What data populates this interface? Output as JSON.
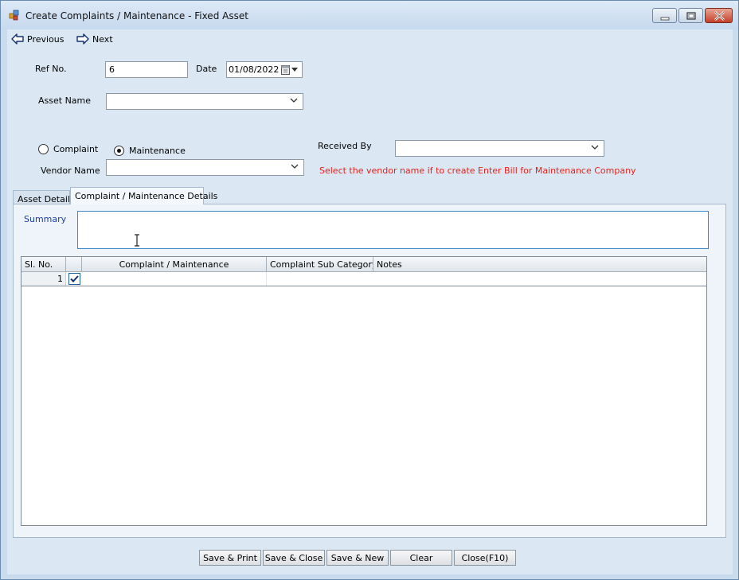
{
  "window": {
    "title": "Create Complaints / Maintenance - Fixed Asset"
  },
  "nav": {
    "previous": "Previous",
    "next": "Next"
  },
  "form": {
    "ref_label": "Ref No.",
    "ref_value": "6",
    "date_label": "Date",
    "date_value": "01/08/2022",
    "asset_label": "Asset Name",
    "asset_value": "",
    "radio_complaint": "Complaint",
    "radio_maintenance": "Maintenance",
    "selected_type": "Maintenance",
    "received_by_label": "Received By",
    "received_by_value": "",
    "vendor_label": "Vendor Name",
    "vendor_value": "",
    "vendor_hint": "Select the vendor name if to  create Enter Bill for Maintenance Company"
  },
  "tabs": [
    {
      "label": "Asset Details",
      "active": false
    },
    {
      "label": "Complaint / Maintenance Details",
      "active": true
    }
  ],
  "details": {
    "summary_label": "Summary",
    "summary_value": "",
    "columns": [
      "Sl. No.",
      "",
      "Complaint / Maintenance",
      "Complaint Sub Category",
      "Notes"
    ],
    "rows": [
      {
        "sl_no": "1",
        "checked": true,
        "complaint": "",
        "sub_category": "",
        "notes": ""
      }
    ]
  },
  "buttons": {
    "save_print": "Save & Print",
    "save_close": "Save & Close",
    "save_new": "Save & New",
    "clear": "Clear",
    "close": "Close(F10)"
  },
  "colors": {
    "hint": "#e8201a",
    "summary_label": "#1b3fa8",
    "accent_border": "#3d88c8"
  },
  "icons": {
    "app": "app-icon",
    "previous": "arrow-left-icon",
    "next": "arrow-right-icon",
    "calendar": "calendar-icon",
    "dropdown": "chevron-down-icon"
  }
}
